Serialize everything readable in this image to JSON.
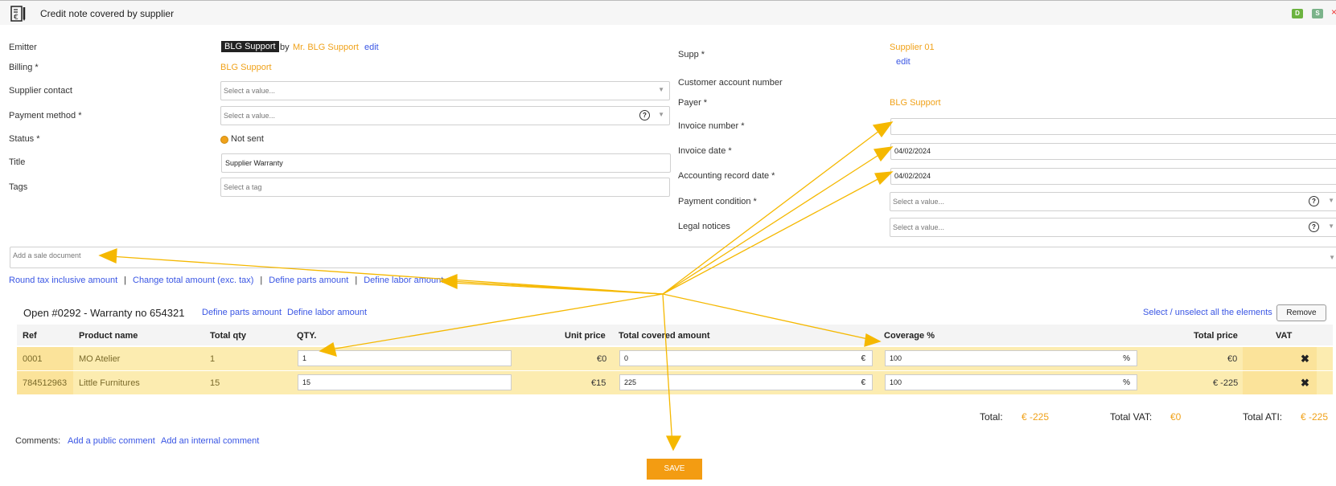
{
  "header": {
    "title": "Credit note covered by supplier",
    "badge_d": "D",
    "badge_s": "S",
    "close": "×"
  },
  "left_form": {
    "emitter_label": "Emitter",
    "emitter_value": "BLG Support",
    "emitter_by": "by",
    "emitter_person": "Mr. BLG Support",
    "emitter_edit": "edit",
    "billing_label": "Billing *",
    "billing_value": "BLG Support",
    "supplier_contact_label": "Supplier contact",
    "supplier_contact_placeholder": "Select a value...",
    "payment_method_label": "Payment method *",
    "payment_method_placeholder": "Select a value...",
    "status_label": "Status *",
    "status_value": "Not sent",
    "title_label": "Title",
    "title_value": "Supplier Warranty",
    "tags_label": "Tags",
    "tags_placeholder": "Select a tag"
  },
  "right_form": {
    "supp_label": "Supp *",
    "supp_value": "Supplier 01",
    "supp_edit": "edit",
    "customer_account_label": "Customer account number",
    "payer_label": "Payer *",
    "payer_value": "BLG Support",
    "invoice_number_label": "Invoice number *",
    "invoice_number_value": "",
    "invoice_date_label": "Invoice date *",
    "invoice_date_value": "04/02/2024",
    "accounting_date_label": "Accounting record date *",
    "accounting_date_value": "04/02/2024",
    "payment_condition_label": "Payment condition *",
    "payment_condition_placeholder": "Select a value...",
    "legal_notices_label": "Legal notices",
    "legal_notices_placeholder": "Select a value..."
  },
  "sale_document_placeholder": "Add a sale document",
  "action_links": {
    "round_tax": "Round tax inclusive amount",
    "change_total": "Change total amount (exc. tax)",
    "define_parts": "Define parts amount",
    "define_labor": "Define labor amount",
    "separator": "|"
  },
  "section": {
    "title": "Open #0292 - Warranty no 654321",
    "define_parts": "Define parts amount",
    "define_labor": "Define labor amount",
    "select_all": "Select / unselect all the elements",
    "remove": "Remove"
  },
  "table": {
    "headers": {
      "ref": "Ref",
      "product": "Product name",
      "total_qty": "Total qty",
      "qty": "QTY.",
      "unit_price": "Unit price",
      "covered": "Total covered amount",
      "coverage": "Coverage %",
      "total_price": "Total price",
      "vat": "VAT"
    },
    "rows": [
      {
        "ref": "0001",
        "product": "MO Atelier",
        "total_qty": "1",
        "qty": "1",
        "unit_price": "€0",
        "covered": "0",
        "covered_unit": "€",
        "coverage": "100",
        "coverage_unit": "%",
        "total_price": "€0",
        "delete": "✖"
      },
      {
        "ref": "784512963",
        "product": "Little Furnitures",
        "total_qty": "15",
        "qty": "15",
        "unit_price": "€15",
        "covered": "225",
        "covered_unit": "€",
        "coverage": "100",
        "coverage_unit": "%",
        "total_price": "€ -225",
        "delete": "✖"
      }
    ]
  },
  "totals": {
    "total_label": "Total:",
    "total_value": "€ -225",
    "vat_label": "Total VAT:",
    "vat_value": "€0",
    "ati_label": "Total ATI:",
    "ati_value": "€ -225"
  },
  "comments": {
    "label": "Comments:",
    "public": "Add a public comment",
    "internal": "Add an internal comment"
  },
  "save_label": "SAVE",
  "colors": {
    "accent": "#f39c12",
    "link": "#3a56e4",
    "row": "#fcecb0",
    "arrow": "#f5b800"
  }
}
